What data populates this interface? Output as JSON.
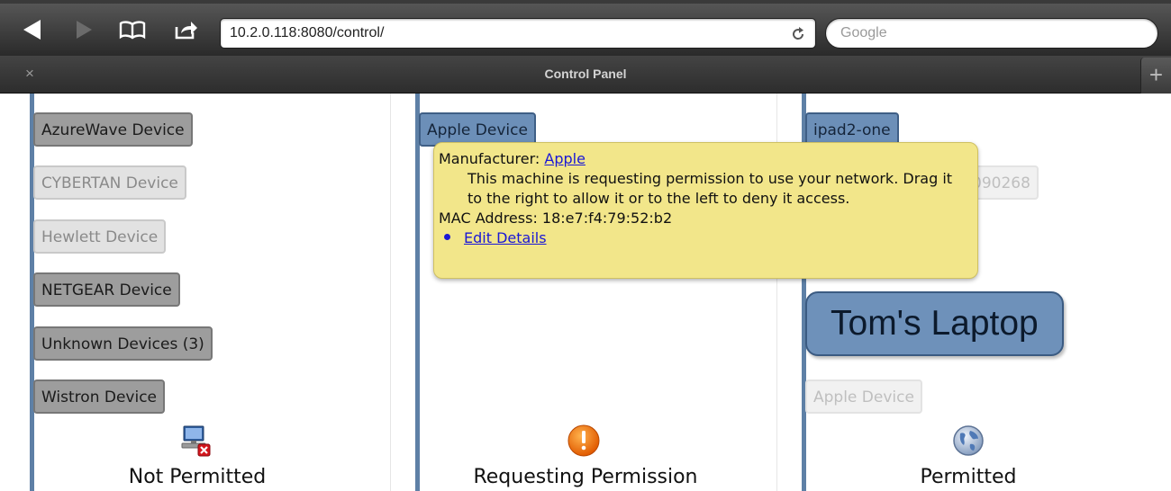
{
  "browser": {
    "url": "10.2.0.118:8080/control/",
    "search_placeholder": "Google",
    "tab_title": "Control Panel",
    "tab_close": "×",
    "new_tab": "+"
  },
  "columns": {
    "not_permitted": {
      "label": "Not Permitted",
      "icon": "computer-denied-icon",
      "devices": [
        "AzureWave Device",
        "CYBERTAN Device",
        "Hewlett Device",
        "NETGEAR Device",
        "Unknown Devices (3)",
        "Wistron Device"
      ]
    },
    "requesting": {
      "label": "Requesting Permission",
      "icon": "warning-icon",
      "devices": [
        "Apple Device"
      ]
    },
    "permitted": {
      "label": "Permitted",
      "icon": "globe-icon",
      "devices": [
        "ipad2-one",
        "090268",
        "Tom's Laptop",
        "Apple Device"
      ]
    }
  },
  "tooltip": {
    "manufacturer_label": "Manufacturer:",
    "manufacturer_link": "Apple",
    "message": "This machine is requesting permission to use your network. Drag it to the right to allow it or to the left to deny it access.",
    "mac_label": "MAC Address: 18:e7:f4:79:52:b2",
    "edit_link": "Edit Details"
  },
  "colors": {
    "column_bar": "#5e80a6",
    "tooltip_bg": "#f2e68a",
    "highlight_device": "#6e91ba"
  }
}
